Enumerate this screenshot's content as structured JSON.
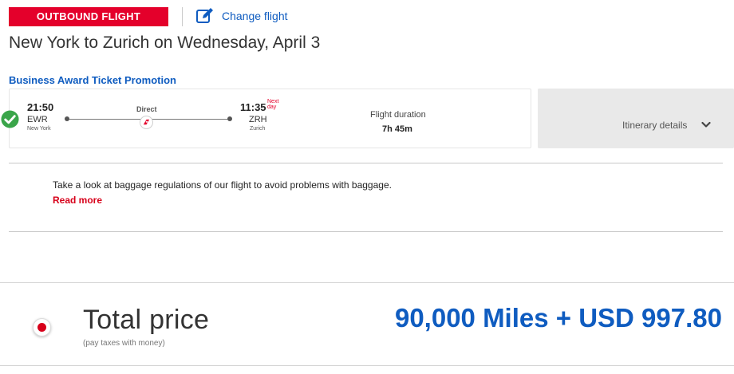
{
  "header": {
    "badge": "OUTBOUND FLIGHT",
    "change_flight": "Change flight",
    "route_title": "New York to Zurich on Wednesday, April 3"
  },
  "promotion": "Business Award Ticket Promotion",
  "flight": {
    "departure": {
      "time": "21:50",
      "code": "EWR",
      "city": "New York"
    },
    "arrival": {
      "time": "11:35",
      "next_day": "Next day",
      "code": "ZRH",
      "city": "Zurich"
    },
    "stops": "Direct",
    "duration_label": "Flight duration",
    "duration": "7h 45m",
    "itinerary_details": "Itinerary details"
  },
  "baggage": {
    "text": "Take a look at baggage regulations of our flight to avoid problems with baggage.",
    "read_more": "Read more"
  },
  "total": {
    "label": "Total price",
    "sublabel": "(pay taxes with money)",
    "price": "90,000 Miles + USD 997.80"
  },
  "icons": {
    "edit": "edit-icon",
    "check": "check-circle-icon",
    "airline": "swiss-airline-logo-icon",
    "chevron": "chevron-down-icon"
  },
  "colors": {
    "brand_red": "#e4002b",
    "link_blue": "#0f5cc0",
    "check_green": "#3aa54a"
  }
}
